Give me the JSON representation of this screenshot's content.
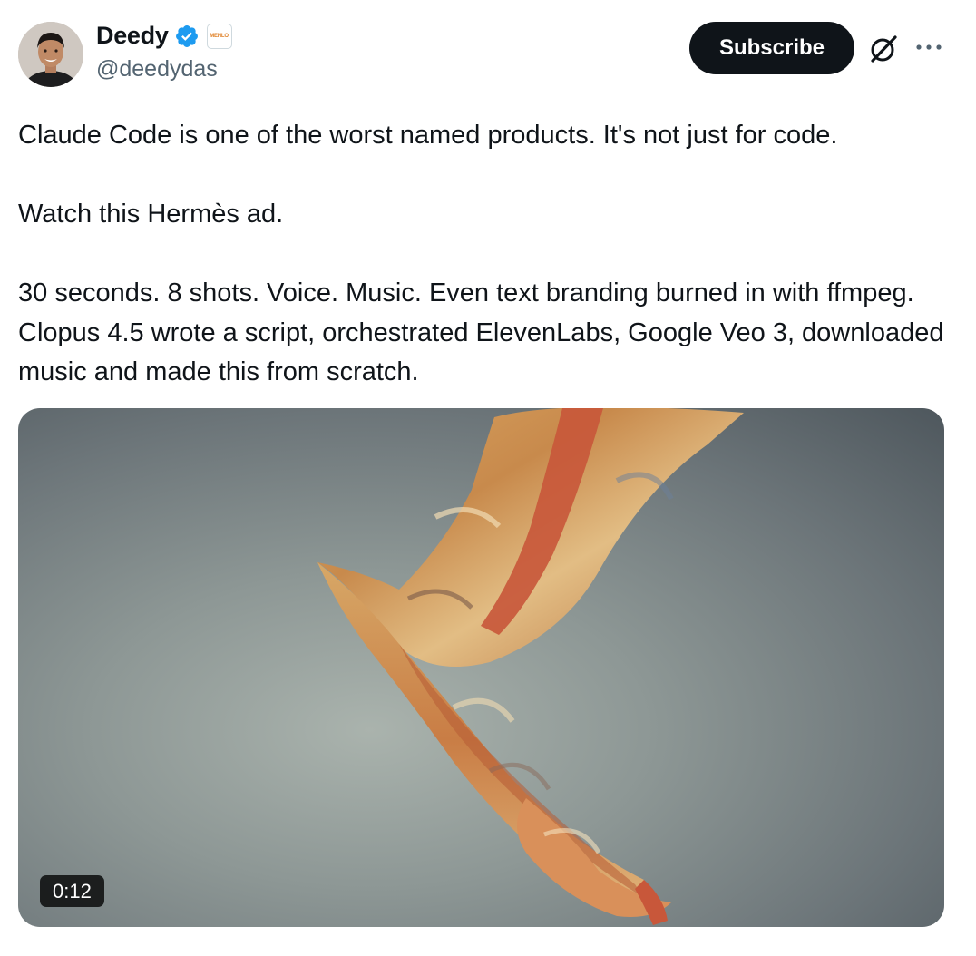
{
  "author": {
    "name": "Deedy",
    "handle": "@deedydas",
    "affiliation_badge_text": "MENLO"
  },
  "actions": {
    "subscribe_label": "Subscribe"
  },
  "tweet": {
    "paragraphs": [
      "Claude Code is one of the worst named products. It's not just for code.",
      "Watch this Hermès ad.",
      "30 seconds. 8 shots. Voice. Music. Even text branding burned in with ffmpeg. Clopus 4.5 wrote a script, orchestrated ElevenLabs, Google Veo 3, downloaded music and made this from scratch."
    ]
  },
  "media": {
    "type": "video",
    "duration": "0:12"
  },
  "icons": {
    "verified": "verified-badge-icon",
    "grok": "grok-icon",
    "more": "more-options-icon"
  },
  "colors": {
    "text": "#0f1419",
    "secondary": "#536471",
    "verified": "#1d9bf0",
    "button_bg": "#0f1419"
  }
}
